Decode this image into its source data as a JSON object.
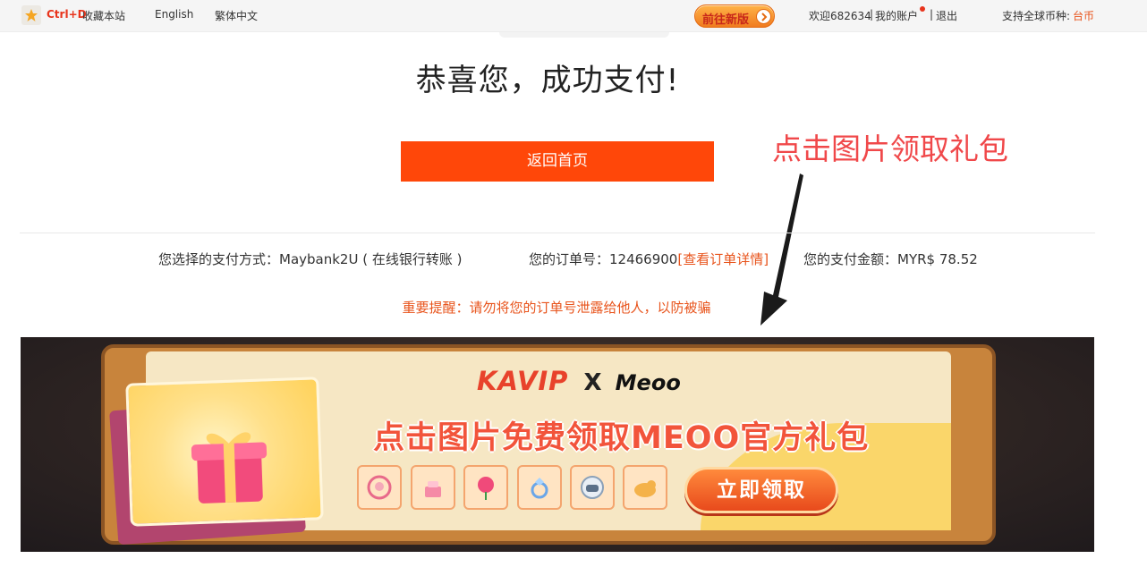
{
  "topbar": {
    "bookmark_key": "Ctrl+D",
    "bookmark_label": "收藏本站",
    "lang_en": "English",
    "lang_tc": "繁体中文",
    "new_version": "前往新版",
    "user_welcome": "欢迎682634",
    "sep1": "|",
    "my_account": "我的账户",
    "sep2": "|",
    "logout": "退出",
    "currency_label": "支持全球币种:",
    "currency_value": "台币"
  },
  "main": {
    "headline": "恭喜您，成功支付!",
    "home_button": "返回首页",
    "annotation": "点击图片领取礼包"
  },
  "info": {
    "payment_method": "您选择的支付方式：Maybank2U ( 在线银行转账 )",
    "order_label": "您的订单号：12466900",
    "order_link": "[查看订单详情]",
    "amount": "您的支付金额：MYR$ 78.52",
    "warning": "重要提醒：请勿将您的订单号泄露给他人，以防被骗"
  },
  "banner": {
    "brand_left": "KAVIP",
    "brand_x": "X",
    "brand_right": "Meoo",
    "title": "点击图片免费领取MEOO官方礼包",
    "claim_button": "立即领取",
    "items": [
      "avatar-frame-icon",
      "cake-icon",
      "rose-icon",
      "ring-icon",
      "helmet-icon",
      "tiger-icon"
    ]
  },
  "colors": {
    "accent": "#ff4709",
    "link": "#e8541c",
    "annotation": "#f0484a"
  }
}
